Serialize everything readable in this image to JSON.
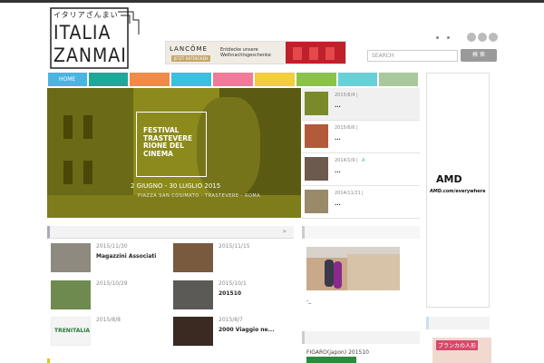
{
  "header": {
    "logo_jp": "イタリアざんまい",
    "logo_line1": "ITALIA",
    "logo_line2": "ZANMAI",
    "banner_brand": "LANCÔME",
    "banner_button": "JETZT ENTDECKEN",
    "banner_text": "Entdecke unsere Weihnachtsgeschenke",
    "search_placeholder": "SEARCH",
    "search_button": "検 索"
  },
  "nav": {
    "items": [
      {
        "label": "HOME",
        "color": "#4ab5e0"
      },
      {
        "label": "",
        "color": "#1fa899"
      },
      {
        "label": "",
        "color": "#f08a4b"
      },
      {
        "label": "",
        "color": "#3dbfe0"
      },
      {
        "label": "",
        "color": "#f07a9a"
      },
      {
        "label": "",
        "color": "#f2cd3d"
      },
      {
        "label": "",
        "color": "#8bc34a"
      },
      {
        "label": "",
        "color": "#6ad0d8"
      },
      {
        "label": "",
        "color": "#a9c89b"
      }
    ]
  },
  "hero": {
    "title": "FESTIVAL TRASTEVERE RIONE DEL CINEMA",
    "date": "2 GIUGNO - 30 LUGLIO 2015",
    "subtitle": "PIAZZA SAN COSIMATO - TRASTEVERE - ROMA"
  },
  "side_list": [
    {
      "date": "2015/6/4",
      "sep": "|",
      "tag": "",
      "title": "..."
    },
    {
      "date": "2015/6/6",
      "sep": "|",
      "tag": "",
      "title": "..."
    },
    {
      "date": "2014/1/9",
      "sep": "|",
      "tag": "A",
      "title": "..."
    },
    {
      "date": "2014/11/21",
      "sep": "|",
      "tag": "",
      "title": "..."
    }
  ],
  "section_mark": "»",
  "articles": [
    {
      "date": "2015/11/30",
      "title": "Magazzini Associati"
    },
    {
      "date": "2015/11/15",
      "title": ""
    },
    {
      "date": "2015/10/29",
      "title": ""
    },
    {
      "date": "2015/10/1",
      "title": "201510"
    },
    {
      "date": "2015/8/8",
      "title": ""
    },
    {
      "date": "2015/8/7",
      "title": "2000 Viaggio ne..."
    }
  ],
  "right_column": {
    "photo_caption": "-_",
    "text2": "FIGARO(japon) 201510"
  },
  "ads": {
    "amd_logo": "AMD",
    "amd_url": "AMD.com/everywhere",
    "bottom_ad_text": "ブランカの人形"
  }
}
